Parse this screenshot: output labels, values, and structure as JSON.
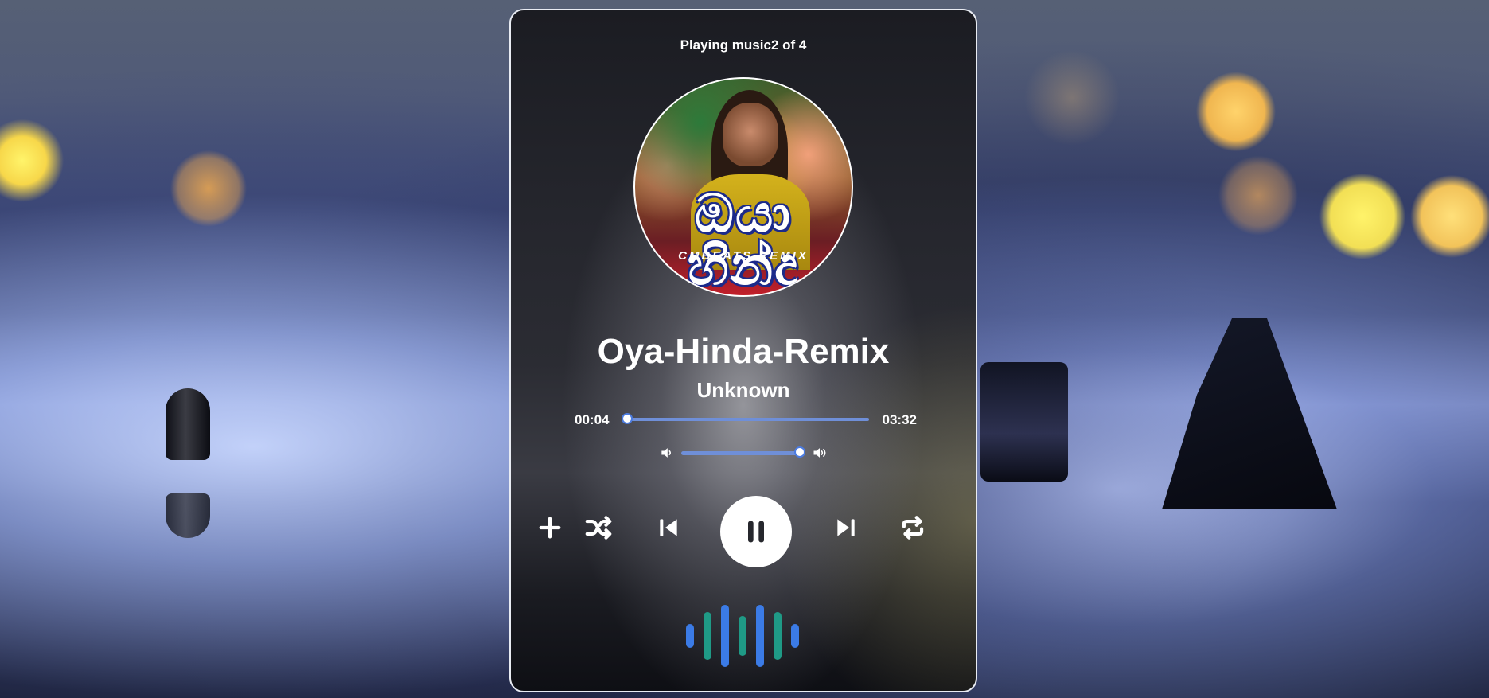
{
  "player": {
    "status_text": "Playing music2 of 4",
    "cover": {
      "title_text": "ඔයා හින්දා",
      "subtitle_text": "CMBEATS REMIX"
    },
    "song_title": "Oya-Hinda-Remix",
    "artist": "Unknown",
    "progress": {
      "current_time": "00:04",
      "total_time": "03:32",
      "fraction": 0.02
    },
    "volume": {
      "fraction": 0.98
    },
    "controls": {
      "add_icon": "plus-icon",
      "shuffle_icon": "shuffle-icon",
      "previous_icon": "skip-previous-icon",
      "play_pause_icon": "pause-icon",
      "next_icon": "skip-next-icon",
      "repeat_icon": "repeat-icon"
    },
    "visualizer_colors": [
      "#3b7be6",
      "#1f9a86"
    ]
  }
}
